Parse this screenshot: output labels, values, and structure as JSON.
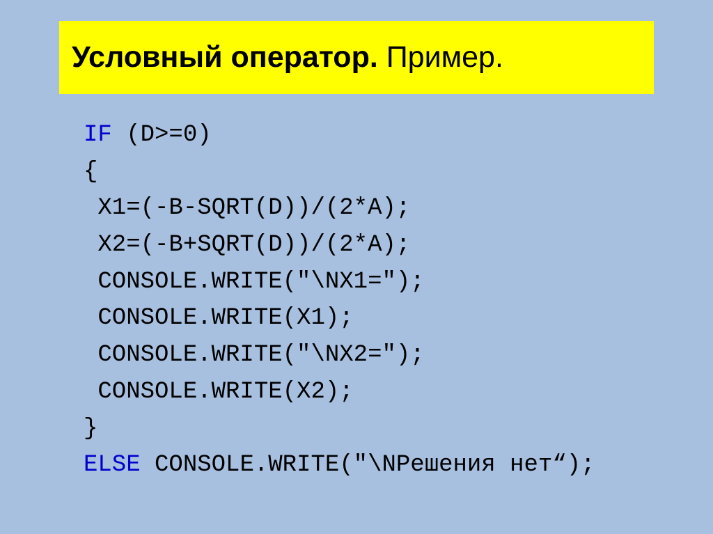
{
  "title": {
    "bold_part": "Условный оператор.",
    "normal_part": " Пример."
  },
  "code": {
    "line1_keyword": "IF",
    "line1_rest": " (D>=0)",
    "line2": "{",
    "line3": " X1=(-B-SQRT(D))/(2*A);",
    "line4": " X2=(-B+SQRT(D))/(2*A);",
    "line5": " CONSOLE.WRITE(\"\\NX1=\");",
    "line6": " CONSOLE.WRITE(X1);",
    "line7": " CONSOLE.WRITE(\"\\NX2=\");",
    "line8": " CONSOLE.WRITE(X2);",
    "line9": "}",
    "line10_keyword": "ELSE",
    "line10_rest": " CONSOLE.WRITE(\"\\NРешения нет“);"
  }
}
